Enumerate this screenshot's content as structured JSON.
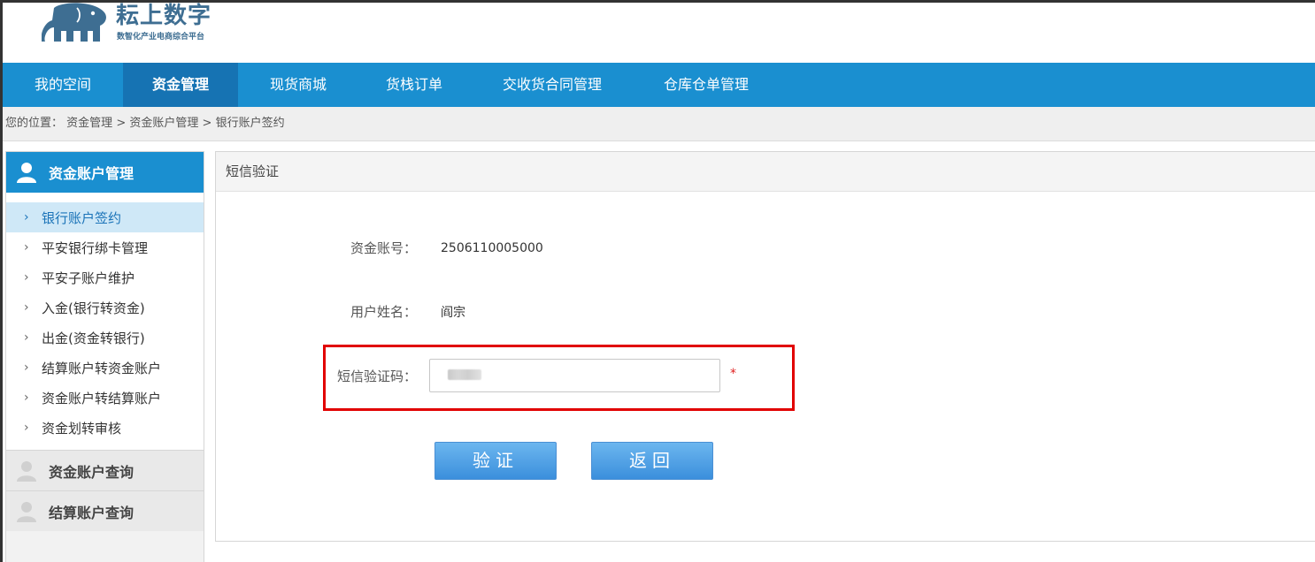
{
  "brand": {
    "name": "耘上数字",
    "tagline": "数智化产业电商综合平台",
    "logo_color": "#3e6e92"
  },
  "nav": {
    "items": [
      {
        "label": "我的空间",
        "active": false
      },
      {
        "label": "资金管理",
        "active": true
      },
      {
        "label": "现货商城",
        "active": false
      },
      {
        "label": "货栈订单",
        "active": false
      },
      {
        "label": "交收货合同管理",
        "active": false
      },
      {
        "label": "仓库仓单管理",
        "active": false
      }
    ],
    "bg_color": "#1a8fd0",
    "active_color": "#1673b3"
  },
  "breadcrumb": {
    "prefix": "您的位置：",
    "crumbs": [
      "资金管理",
      "资金账户管理",
      "银行账户签约"
    ],
    "separator": ">"
  },
  "sidebar": {
    "sections": [
      {
        "title": "资金账户管理",
        "icon": "user-icon",
        "expanded": true
      },
      {
        "title": "资金账户查询",
        "icon": "user-icon",
        "expanded": false
      },
      {
        "title": "结算账户查询",
        "icon": "user-icon",
        "expanded": false
      }
    ],
    "items": [
      {
        "label": "银行账户签约",
        "active": true
      },
      {
        "label": "平安银行绑卡管理",
        "active": false
      },
      {
        "label": "平安子账户维护",
        "active": false
      },
      {
        "label": "入金(银行转资金)",
        "active": false
      },
      {
        "label": "出金(资金转银行)",
        "active": false
      },
      {
        "label": "结算账户转资金账户",
        "active": false
      },
      {
        "label": "资金账户转结算账户",
        "active": false
      },
      {
        "label": "资金划转审核",
        "active": false
      }
    ]
  },
  "panel": {
    "title": "短信验证",
    "fields": {
      "account_label": "资金账号：",
      "account_value": "2506110005000",
      "name_label": "用户姓名：",
      "name_value": "阎宗",
      "code_label": "短信验证码：",
      "code_value": "",
      "required_mark": "*"
    },
    "buttons": {
      "verify": "验证",
      "back": "返回"
    },
    "highlight_color": "#e10000"
  }
}
